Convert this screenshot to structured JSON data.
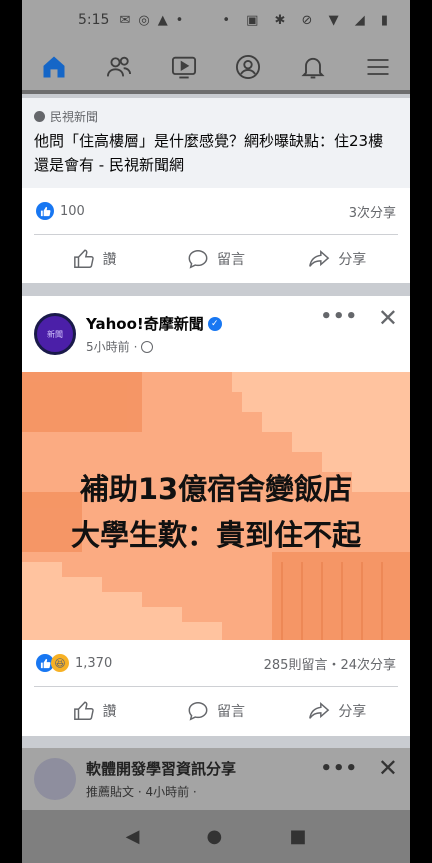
{
  "status": {
    "time": "5:15"
  },
  "nav": {
    "items": [
      "home-icon",
      "friends-icon",
      "watch-icon",
      "profile-icon",
      "notifications-icon",
      "menu-icon"
    ],
    "active": "home-icon"
  },
  "post1": {
    "source": "民視新聞",
    "headline": "他問「住高樓層」是什麼感覺？網秒曝缺點：住23樓還是會有 - 民視新聞網",
    "reaction_count": "100",
    "shares": "3次分享",
    "actions": {
      "like": "讚",
      "comment": "留言",
      "share": "分享"
    }
  },
  "post2": {
    "page_name": "Yahoo!奇摩新聞",
    "time": "5小時前",
    "image_line1": "補助13億宿舍變飯店",
    "image_line2": "大學生歎：貴到住不起",
    "reaction_count": "1,370",
    "comments_shares": "285則留言・24次分享",
    "actions": {
      "like": "讚",
      "comment": "留言",
      "share": "分享"
    }
  },
  "post3": {
    "name": "軟體開發學習資訊分享",
    "sub": "推薦貼文 · 4小時前 ·"
  },
  "colors": {
    "facebook_blue": "#1877f2",
    "image_bg": "#fbab82"
  }
}
